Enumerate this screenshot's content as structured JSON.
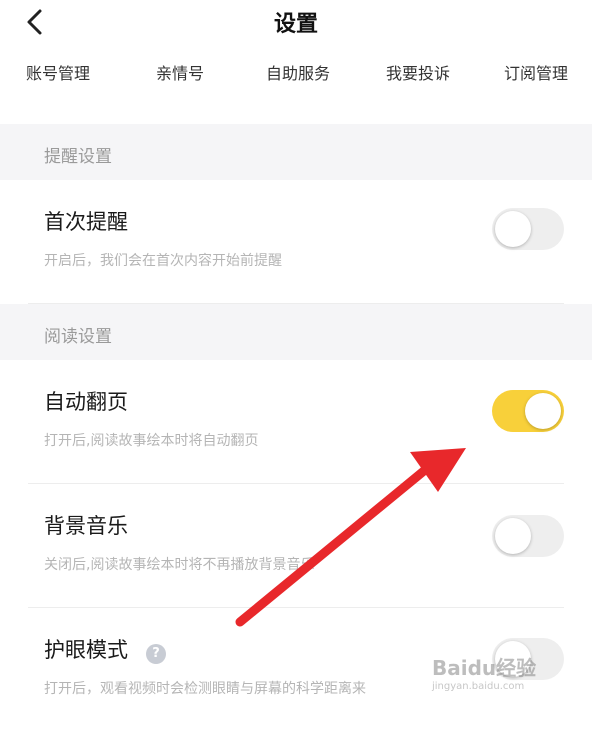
{
  "header": {
    "title": "设置"
  },
  "tabs": [
    "账号管理",
    "亲情号",
    "自助服务",
    "我要投诉",
    "订阅管理"
  ],
  "sections": [
    {
      "title": "提醒设置",
      "items": [
        {
          "label": "首次提醒",
          "desc": "开启后，我们会在首次内容开始前提醒",
          "toggle_on": false
        }
      ]
    },
    {
      "title": "阅读设置",
      "items": [
        {
          "label": "自动翻页",
          "desc": "打开后,阅读故事绘本时将自动翻页",
          "toggle_on": true
        },
        {
          "label": "背景音乐",
          "desc": "关闭后,阅读故事绘本时将不再播放背景音乐",
          "toggle_on": false
        },
        {
          "label": "护眼模式",
          "desc": "打开后，观看视频时会检测眼睛与屏幕的科学距离来",
          "toggle_on": false,
          "help_icon": "question-icon"
        }
      ]
    }
  ],
  "colors": {
    "toggle_on": "#f8d03a",
    "arrow": "#e8282b",
    "section_bg": "#f5f5f7"
  },
  "watermark": {
    "text": "Baidu经验",
    "sub": "jingyan.baidu.com"
  }
}
